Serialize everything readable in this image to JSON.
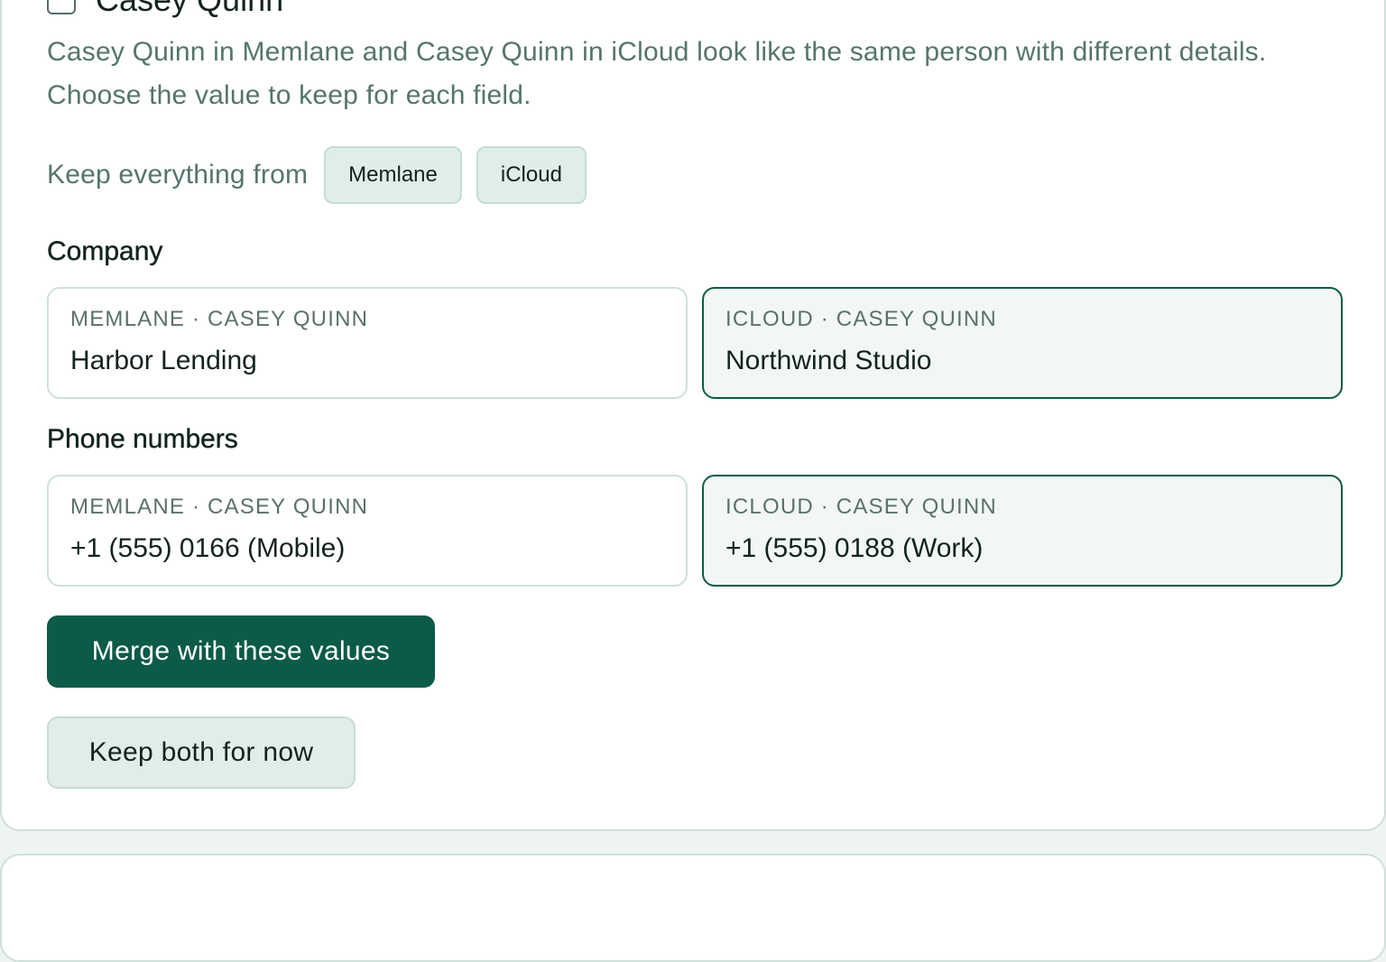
{
  "conflict": {
    "contact_name": "Casey Quinn",
    "description": "Casey Quinn in Memlane and Casey Quinn in iCloud look like the same person with different details. Choose the value to keep for each field.",
    "keep_everything_label": "Keep everything from",
    "keep_sources": [
      "Memlane",
      "iCloud"
    ],
    "fields": {
      "company": {
        "title": "Company",
        "options": [
          {
            "source_label": "MEMLANE · CASEY QUINN",
            "value": "Harbor Lending",
            "selected": false
          },
          {
            "source_label": "ICLOUD · CASEY QUINN",
            "value": "Northwind Studio",
            "selected": true
          }
        ]
      },
      "phone": {
        "title": "Phone numbers",
        "options": [
          {
            "source_label": "MEMLANE · CASEY QUINN",
            "value": "+1 (555) 0166 (Mobile)",
            "selected": false
          },
          {
            "source_label": "ICLOUD · CASEY QUINN",
            "value": "+1 (555) 0188 (Work)",
            "selected": true
          }
        ]
      }
    },
    "merge_button": "Merge with these values",
    "keep_both_button": "Keep both for now"
  },
  "next_card": {
    "title": ""
  },
  "colors": {
    "primary": "#0c5a48",
    "secondary_bg": "#e1ede8",
    "muted_text": "#55756b",
    "border": "#cfe0d9",
    "selected_border": "#0f5a48"
  }
}
